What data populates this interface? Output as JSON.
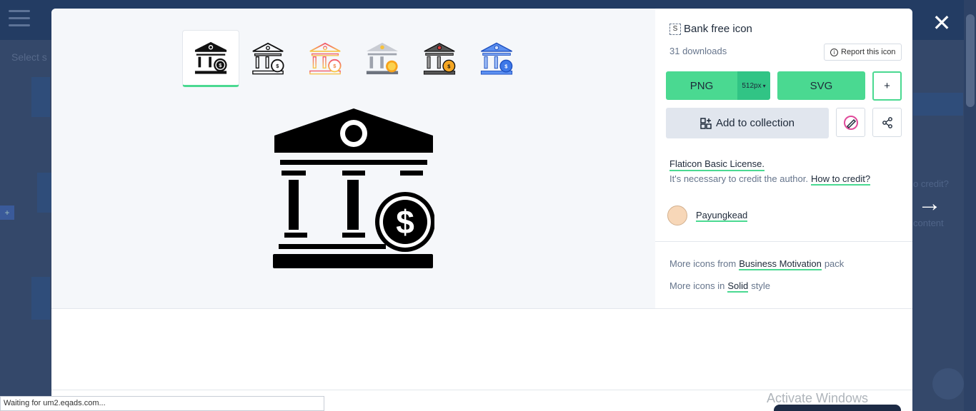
{
  "background": {
    "select_text": "Select s",
    "credit_hint": "o credit?",
    "content_hint": "content"
  },
  "close_label": "✕",
  "icon": {
    "title": "Bank free icon",
    "style_glyph": "S",
    "downloads": "31 downloads",
    "report_label": "Report this icon",
    "variants": [
      {
        "name": "solid-black",
        "active": true
      },
      {
        "name": "lineal",
        "active": false
      },
      {
        "name": "gradient-lineal",
        "active": false
      },
      {
        "name": "flat",
        "active": false
      },
      {
        "name": "lineal-color",
        "active": false
      },
      {
        "name": "blue",
        "active": false
      }
    ]
  },
  "actions": {
    "png_label": "PNG",
    "size_label": "512px",
    "svg_label": "SVG",
    "plus_label": "+",
    "collection_label": "Add to collection"
  },
  "license": {
    "name": "Flaticon Basic License.",
    "credit_text": "It's necessary to credit the author.",
    "credit_link": "How to credit?"
  },
  "author": {
    "name": "Payungkead"
  },
  "more": {
    "pack_prefix": "More icons from",
    "pack_name": "Business Motivation",
    "pack_suffix": "pack",
    "style_prefix": "More icons in",
    "style_name": "Solid",
    "style_suffix": "style"
  },
  "status_bar": "Waiting for um2.eqads.com...",
  "watermark": "Activate Windows",
  "colors": {
    "accent_green": "#4ad991",
    "dark_text": "#1d2939",
    "muted_text": "#66758c"
  }
}
